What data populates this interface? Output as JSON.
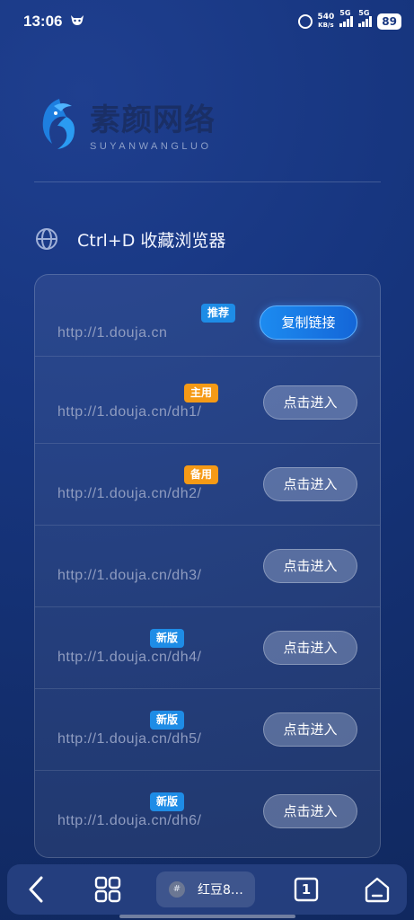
{
  "status_bar": {
    "time": "13:06",
    "speed_value": "540",
    "speed_unit": "KB/s",
    "network_1": "5G",
    "network_2": "5G",
    "battery": "89"
  },
  "logo": {
    "name_cn": "素颜网络",
    "name_en": "SUYANWANGLUO"
  },
  "heading": {
    "text": "Ctrl+D 收藏浏览器"
  },
  "links": [
    {
      "url": "http://1.douja.cn",
      "badge": "推荐",
      "badge_color": "#1e8ce6",
      "button": "复制链接",
      "primary": true
    },
    {
      "url": "http://1.douja.cn/dh1/",
      "badge": "主用",
      "badge_color": "#f59a16",
      "button": "点击进入",
      "primary": false
    },
    {
      "url": "http://1.douja.cn/dh2/",
      "badge": "备用",
      "badge_color": "#f59a16",
      "button": "点击进入",
      "primary": false
    },
    {
      "url": "http://1.douja.cn/dh3/",
      "badge": "",
      "badge_color": "",
      "button": "点击进入",
      "primary": false
    },
    {
      "url": "http://1.douja.cn/dh4/",
      "badge": "新版",
      "badge_color": "#1e8ce6",
      "button": "点击进入",
      "primary": false
    },
    {
      "url": "http://1.douja.cn/dh5/",
      "badge": "新版",
      "badge_color": "#1e8ce6",
      "button": "点击进入",
      "primary": false
    },
    {
      "url": "http://1.douja.cn/dh6/",
      "badge": "新版",
      "badge_color": "#1e8ce6",
      "button": "点击进入",
      "primary": false
    }
  ],
  "nav": {
    "tab_title": "红豆8…",
    "tab_count": "1",
    "tab_favicon": "#"
  },
  "colors": {
    "accent": "#1c8bf0",
    "badge_blue": "#1e8ce6",
    "badge_orange": "#f59a16"
  }
}
